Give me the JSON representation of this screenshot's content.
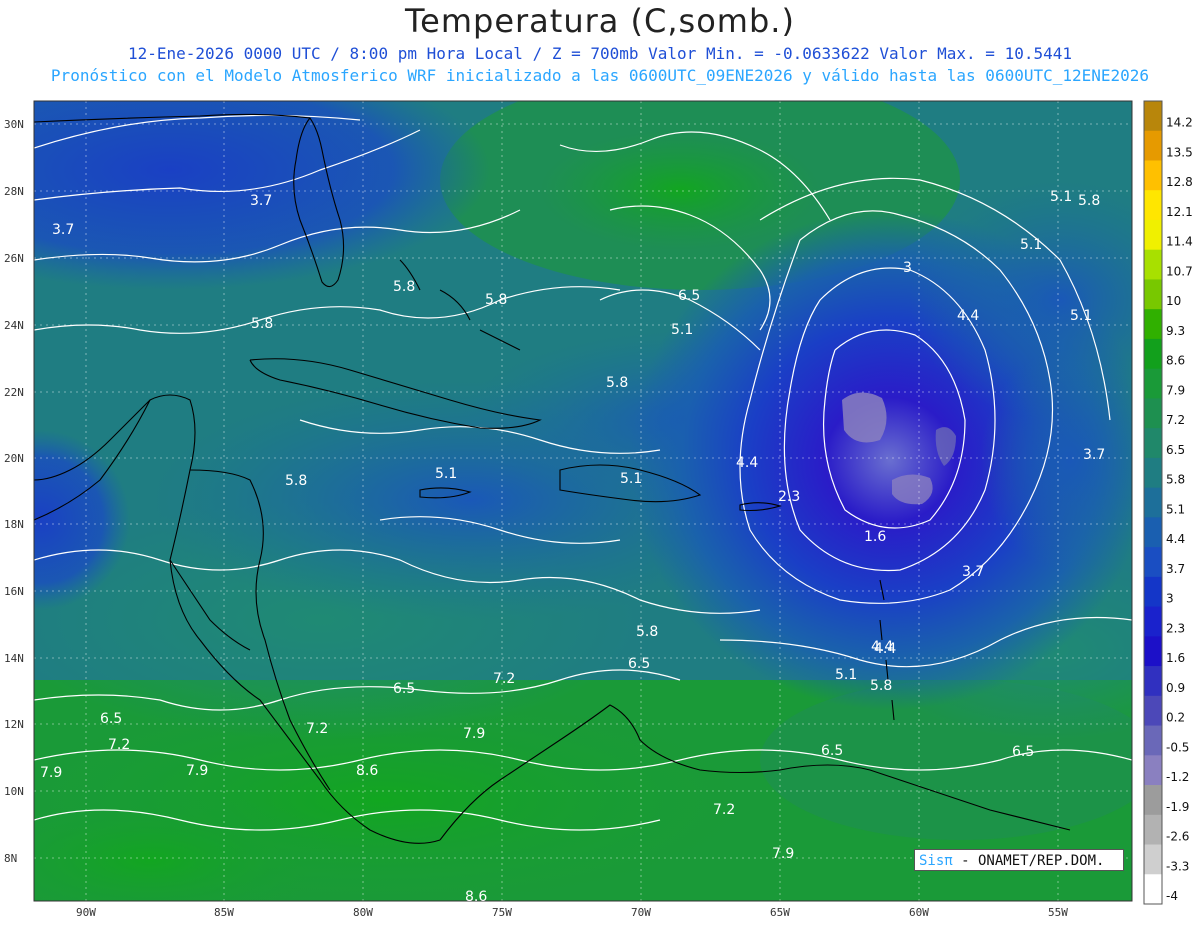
{
  "title": "Temperatura (C,somb.)",
  "subtitle_line1": "12-Ene-2026  0000 UTC / 8:00 pm Hora Local / Z = 700mb  Valor Min. = -0.0633622  Valor Max. = 10.5441",
  "subtitle_line2": "Pronóstico con el Modelo Atmosferico WRF inicializado a las 0600UTC_09ENE2026 y válido hasta las  0600UTC_12ENE2026",
  "credit": {
    "logo": "Sisπ",
    "text": " - ONAMET/REP.DOM."
  },
  "colors": {
    "title": "#222222",
    "subtitle1": "#1f4fd6",
    "subtitle2": "#2ba6ff",
    "contour": "#ffffff",
    "coastline": "#000000"
  },
  "axes": {
    "lat_ticks": [
      "30N",
      "28N",
      "26N",
      "24N",
      "22N",
      "20N",
      "18N",
      "16N",
      "14N",
      "12N",
      "10N",
      "8N"
    ],
    "lon_ticks": [
      "90W",
      "85W",
      "80W",
      "75W",
      "70W",
      "65W",
      "60W",
      "55W"
    ],
    "lon_range": [
      -92,
      -54.5
    ],
    "lat_range": [
      6.8,
      30.5
    ]
  },
  "colorbar": {
    "labels": [
      "14.2",
      "13.5",
      "12.8",
      "12.1",
      "11.4",
      "10.7",
      "10",
      "9.3",
      "8.6",
      "7.9",
      "7.2",
      "6.5",
      "5.8",
      "5.1",
      "4.4",
      "3.7",
      "3",
      "2.3",
      "1.6",
      "0.9",
      "0.2",
      "-0.5",
      "-1.2",
      "-1.9",
      "-2.6",
      "-3.3",
      "-4"
    ],
    "colors": [
      "#b8860b",
      "#e69a00",
      "#ffc000",
      "#ffe600",
      "#f0f000",
      "#a8e000",
      "#78c800",
      "#30b000",
      "#12a01c",
      "#1a9a38",
      "#1e9050",
      "#20886a",
      "#1f7d82",
      "#1d6f9a",
      "#1a5fb0",
      "#1a4ec2",
      "#1436c8",
      "#1a22cc",
      "#1c10c8",
      "#3030c0",
      "#4c48b8",
      "#6a68b8",
      "#8a80c0",
      "#9c9c9c",
      "#b2b2b2",
      "#cfcfcf",
      "#ffffff"
    ]
  },
  "contour_labels": [
    "3.7",
    "3.7",
    "5.8",
    "5.8",
    "5.8",
    "6.5",
    "5.1",
    "5.1",
    "4.4",
    "5.1",
    "5.1",
    "3",
    "4.4",
    "5.8",
    "5.8",
    "5.8",
    "5.1",
    "5.1",
    "4.4",
    "3.7",
    "2.3",
    "1.6",
    "3.7",
    "4.4",
    "5.1",
    "5.8",
    "5.8",
    "6.5",
    "6.5",
    "6.5",
    "7.2",
    "7.2",
    "7.2",
    "7.9",
    "7.9",
    "8.6",
    "7.9",
    "7.2",
    "6.5",
    "7.9",
    "8.6",
    "6.5"
  ],
  "chart_data": {
    "type": "heatmap",
    "field": "Temperatura (C,somb.) at 700mb",
    "value_min": -0.0633622,
    "value_max": 10.5441,
    "contour_values_labeled": [
      1.6,
      2.3,
      3,
      3.7,
      4.4,
      5.1,
      5.8,
      6.5,
      7.2,
      7.9,
      8.6
    ],
    "cold_core_center": {
      "lon": -61.5,
      "lat": 20.5,
      "value": 1.6
    },
    "warm_region": {
      "lon": -80,
      "lat": 10,
      "value": 8.6
    }
  }
}
